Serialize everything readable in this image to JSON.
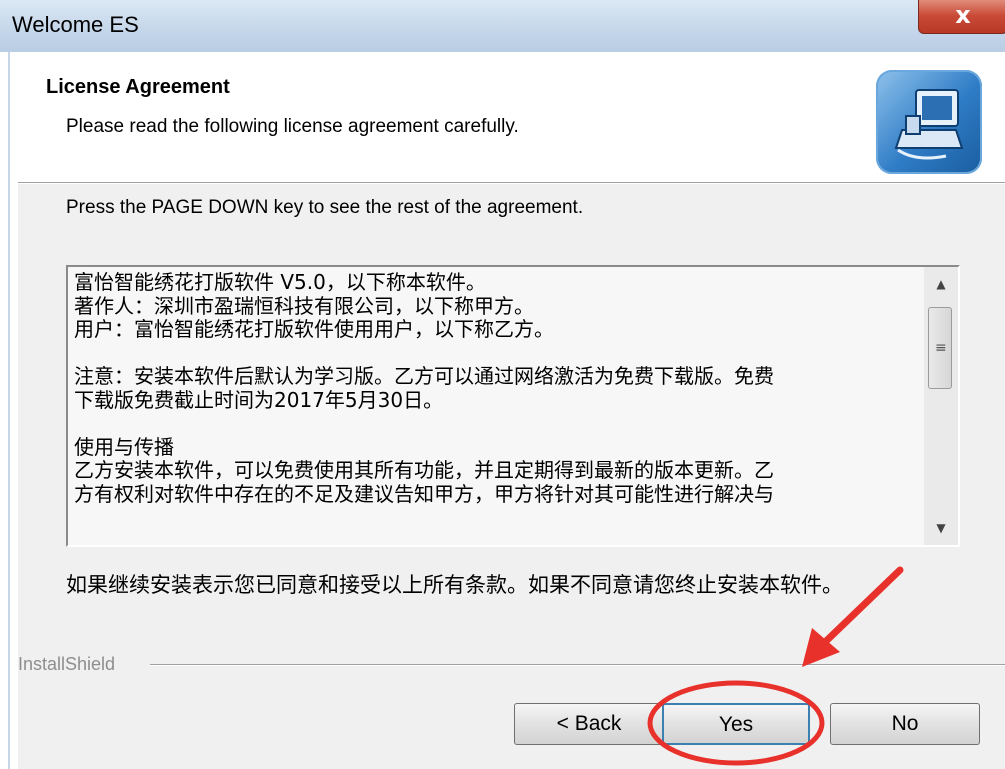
{
  "window": {
    "title": "Welcome ES",
    "close_glyph": "x"
  },
  "header": {
    "title": "License Agreement",
    "subtitle": "Please read the following license agreement carefully.",
    "icon": "setup-computer-icon"
  },
  "body": {
    "instruction": "Press the PAGE DOWN key to see the rest of the agreement.",
    "license_lines": [
      "富怡智能绣花打版软件 V5.0，以下称本软件。",
      "著作人：深圳市盈瑞恒科技有限公司，以下称甲方。",
      "用户：富怡智能绣花打版软件使用用户，以下称乙方。",
      "",
      "注意：安装本软件后默认为学习版。乙方可以通过网络激活为免费下载版。免费",
      "下载版免费截止时间为2017年5月30日。",
      "",
      "使用与传播",
      "乙方安装本软件，可以免费使用其所有功能，并且定期得到最新的版本更新。乙",
      "方有权利对软件中存在的不足及建议告知甲方，甲方将针对其可能性进行解决与"
    ],
    "agreement_prompt": "如果继续安装表示您已同意和接受以上所有条款。如果不同意请您终止安装本软件。"
  },
  "footer": {
    "brand": "InstallShield",
    "back_label": "< Back",
    "yes_label": "Yes",
    "no_label": "No"
  },
  "colors": {
    "annotation": "#e8312a",
    "titlebar": "#c4d6ea",
    "close": "#c94a36"
  }
}
